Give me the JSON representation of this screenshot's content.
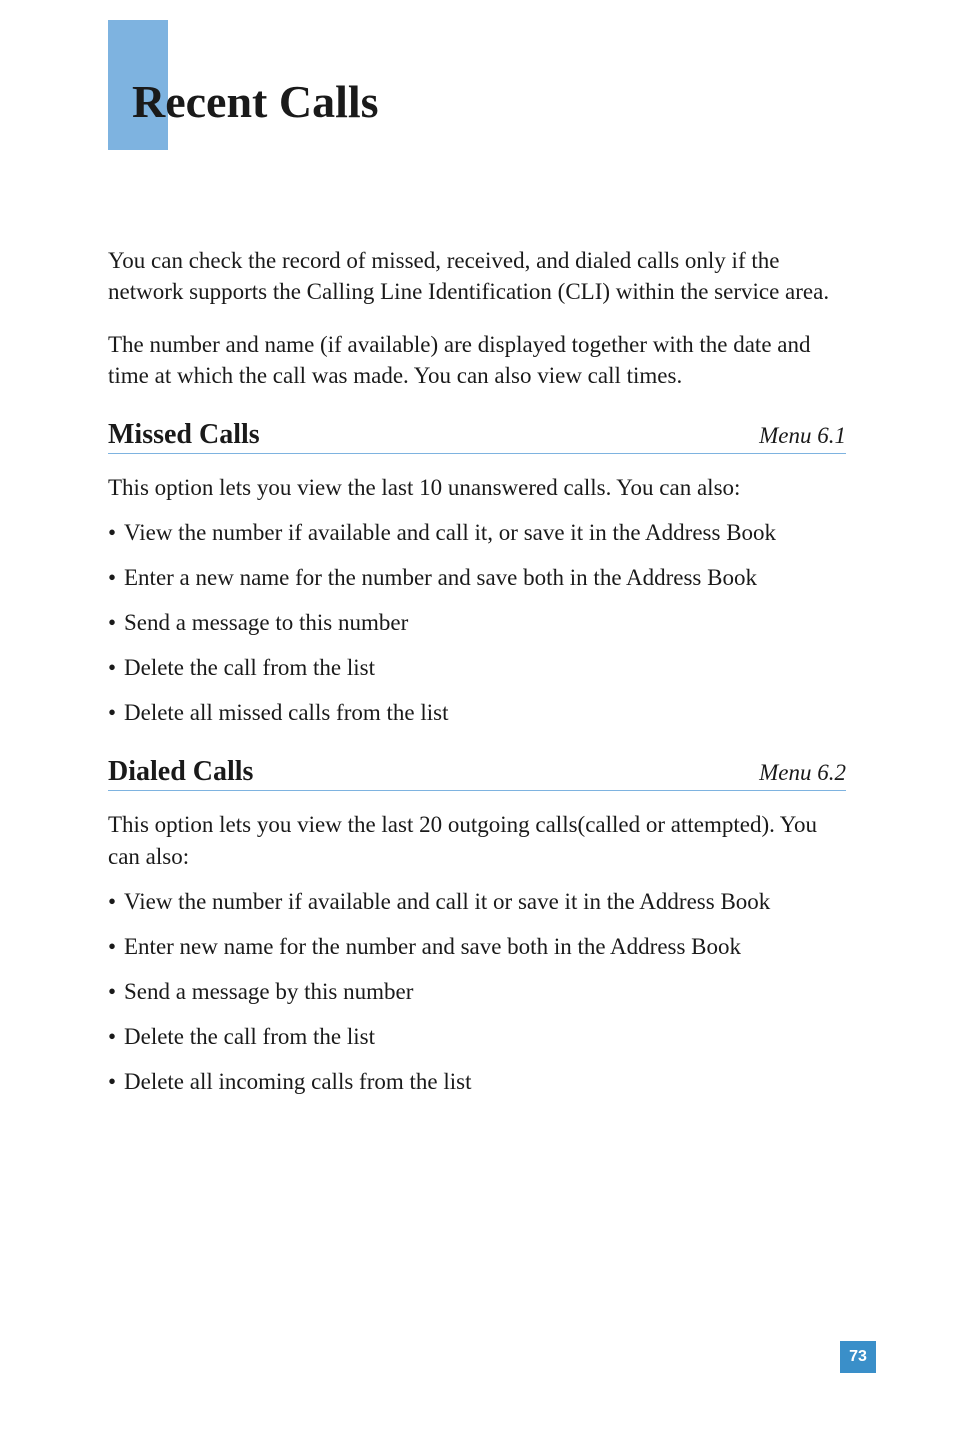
{
  "title": "Recent Calls",
  "intro": {
    "p1": "You can check the record of missed, received, and dialed calls only if the network supports the Calling Line Identification (CLI) within the service area.",
    "p2": "The number and name (if available) are displayed together with the date and time at which the call was made. You can also view call times."
  },
  "sections": [
    {
      "title": "Missed Calls",
      "menu": "Menu 6.1",
      "intro": "This option lets you view the last 10 unanswered calls. You can also:",
      "bullets": [
        "View the number if available and call it, or save it in the Address Book",
        "Enter a new name for the number and save both in the Address Book",
        "Send a message to this number",
        "Delete the call from the list",
        "Delete all missed calls from the list"
      ]
    },
    {
      "title": "Dialed Calls",
      "menu": "Menu 6.2",
      "intro": "This option lets you view the last 20 outgoing calls(called or attempted). You can also:",
      "bullets": [
        "View the number if available and call it or save it in the Address Book",
        "Enter new name for the number and save both in the Address Book",
        "Send a message by this number",
        "Delete the call from the list",
        "Delete all incoming calls from the list"
      ]
    }
  ],
  "pageNumber": "73"
}
